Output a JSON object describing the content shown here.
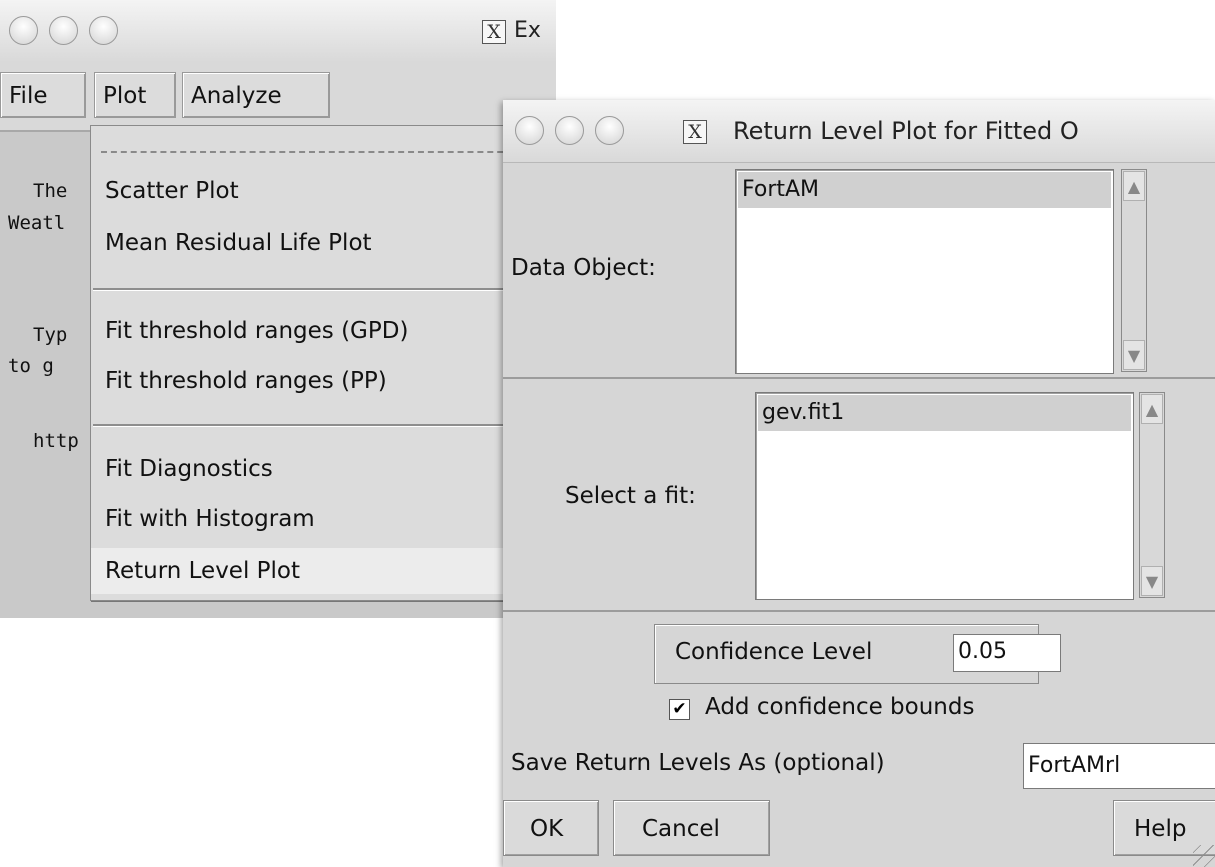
{
  "main_window": {
    "title": "Ex",
    "menubar": {
      "file": "File",
      "plot": "Plot",
      "analyze": "Analyze"
    },
    "console_lines": [
      "The",
      "Weatl",
      "Typ",
      "to g",
      "http"
    ]
  },
  "plot_menu": {
    "items": [
      "Scatter Plot",
      "Mean Residual Life Plot",
      "Fit threshold ranges (GPD)",
      "Fit threshold ranges (PP)",
      "Fit Diagnostics",
      "Fit with Histogram",
      "Return Level Plot"
    ],
    "highlighted": "Return Level Plot"
  },
  "dialog": {
    "title": "Return Level Plot for Fitted O",
    "data_object": {
      "label": "Data Object:",
      "items": [
        "FortAM"
      ]
    },
    "select_fit": {
      "label": "Select a fit:",
      "items": [
        "gev.fit1"
      ]
    },
    "confidence": {
      "label": "Confidence Level",
      "value": "0.05"
    },
    "confidence_bounds": {
      "label": "Add confidence bounds",
      "checked": true,
      "check_glyph": "✔"
    },
    "save_as": {
      "label": "Save Return Levels As (optional)",
      "value": "FortAMrl"
    },
    "buttons": {
      "ok": "OK",
      "cancel": "Cancel",
      "help": "Help"
    }
  }
}
